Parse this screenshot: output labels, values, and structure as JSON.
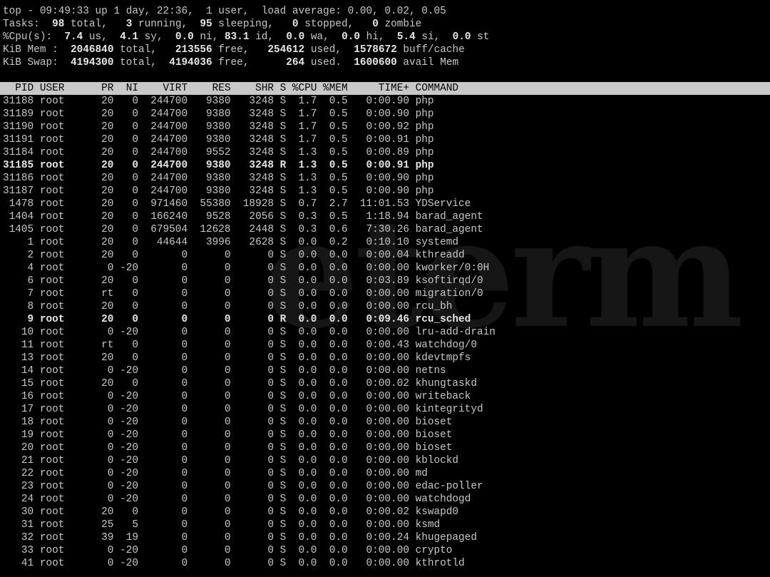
{
  "summary": {
    "top": {
      "label": "top - 09:49:33 up 1 day, 22:36,  1 user,  load average: 0.00, 0.02, 0.05"
    },
    "tasks": {
      "prefix": "Tasks: ",
      "total": " 98",
      "a": " total,   ",
      "running": "3",
      "b": " running,  ",
      "sleeping": "95",
      "c": " sleeping,   ",
      "stopped": "0",
      "d": " stopped,   ",
      "zombie": "0",
      "e": " zombie"
    },
    "cpu": {
      "prefix": "%Cpu(s):  ",
      "us": "7.4",
      "a": " us,  ",
      "sy": "4.1",
      "b": " sy,  ",
      "ni": "0.0",
      "c": " ni, ",
      "id": "83.1",
      "d": " id,  ",
      "wa": "0.0",
      "e": " wa,  ",
      "hi": "0.0",
      "f": " hi,  ",
      "si": "5.4",
      "g": " si,  ",
      "st": "0.0",
      "h": " st"
    },
    "mem": {
      "prefix": "KiB Mem :  ",
      "total": "2046840",
      "a": " total,   ",
      "free": "213556",
      "b": " free,   ",
      "used": "254612",
      "c": " used,  ",
      "cache": "1578672",
      "d": " buff/cache"
    },
    "swap": {
      "prefix": "KiB Swap:  ",
      "total": "4194300",
      "a": " total,  ",
      "free": "4194036",
      "b": " free,      ",
      "used": "264",
      "c": " used.  ",
      "avail": "1600600",
      "d": " avail Mem"
    }
  },
  "table": {
    "header": "  PID USER      PR  NI    VIRT    RES    SHR S %CPU %MEM     TIME+ COMMAND",
    "rows": [
      {
        "text": "31188 root      20   0  244700   9380   3248 S  1.7  0.5   0:00.90 php",
        "bold": false
      },
      {
        "text": "31189 root      20   0  244700   9380   3248 S  1.7  0.5   0:00.90 php",
        "bold": false
      },
      {
        "text": "31190 root      20   0  244700   9380   3248 S  1.7  0.5   0:00.92 php",
        "bold": false
      },
      {
        "text": "31191 root      20   0  244700   9380   3248 S  1.7  0.5   0:00.91 php",
        "bold": false
      },
      {
        "text": "31184 root      20   0  244700   9552   3248 S  1.3  0.5   0:00.89 php",
        "bold": false
      },
      {
        "text": "31185 root      20   0  244700   9380   3248 R  1.3  0.5   0:00.91 php",
        "bold": true
      },
      {
        "text": "31186 root      20   0  244700   9380   3248 S  1.3  0.5   0:00.90 php",
        "bold": false
      },
      {
        "text": "31187 root      20   0  244700   9380   3248 S  1.3  0.5   0:00.90 php",
        "bold": false
      },
      {
        "text": " 1478 root      20   0  971460  55380  18928 S  0.7  2.7  11:01.53 YDService",
        "bold": false
      },
      {
        "text": " 1404 root      20   0  166240   9528   2056 S  0.3  0.5   1:18.94 barad_agent",
        "bold": false
      },
      {
        "text": " 1405 root      20   0  679504  12628   2448 S  0.3  0.6   7:30.26 barad_agent",
        "bold": false
      },
      {
        "text": "    1 root      20   0   44644   3996   2628 S  0.0  0.2   0:10.10 systemd",
        "bold": false
      },
      {
        "text": "    2 root      20   0       0      0      0 S  0.0  0.0   0:00.04 kthreadd",
        "bold": false
      },
      {
        "text": "    4 root       0 -20       0      0      0 S  0.0  0.0   0:00.00 kworker/0:0H",
        "bold": false
      },
      {
        "text": "    6 root      20   0       0      0      0 S  0.0  0.0   0:03.89 ksoftirqd/0",
        "bold": false
      },
      {
        "text": "    7 root      rt   0       0      0      0 S  0.0  0.0   0:00.00 migration/0",
        "bold": false
      },
      {
        "text": "    8 root      20   0       0      0      0 S  0.0  0.0   0:00.00 rcu_bh",
        "bold": false
      },
      {
        "text": "    9 root      20   0       0      0      0 R  0.0  0.0   0:09.46 rcu_sched",
        "bold": true
      },
      {
        "text": "   10 root       0 -20       0      0      0 S  0.0  0.0   0:00.00 lru-add-drain",
        "bold": false
      },
      {
        "text": "   11 root      rt   0       0      0      0 S  0.0  0.0   0:00.43 watchdog/0",
        "bold": false
      },
      {
        "text": "   13 root      20   0       0      0      0 S  0.0  0.0   0:00.00 kdevtmpfs",
        "bold": false
      },
      {
        "text": "   14 root       0 -20       0      0      0 S  0.0  0.0   0:00.00 netns",
        "bold": false
      },
      {
        "text": "   15 root      20   0       0      0      0 S  0.0  0.0   0:00.02 khungtaskd",
        "bold": false
      },
      {
        "text": "   16 root       0 -20       0      0      0 S  0.0  0.0   0:00.00 writeback",
        "bold": false
      },
      {
        "text": "   17 root       0 -20       0      0      0 S  0.0  0.0   0:00.00 kintegrityd",
        "bold": false
      },
      {
        "text": "   18 root       0 -20       0      0      0 S  0.0  0.0   0:00.00 bioset",
        "bold": false
      },
      {
        "text": "   19 root       0 -20       0      0      0 S  0.0  0.0   0:00.00 bioset",
        "bold": false
      },
      {
        "text": "   20 root       0 -20       0      0      0 S  0.0  0.0   0:00.00 bioset",
        "bold": false
      },
      {
        "text": "   21 root       0 -20       0      0      0 S  0.0  0.0   0:00.00 kblockd",
        "bold": false
      },
      {
        "text": "   22 root       0 -20       0      0      0 S  0.0  0.0   0:00.00 md",
        "bold": false
      },
      {
        "text": "   23 root       0 -20       0      0      0 S  0.0  0.0   0:00.00 edac-poller",
        "bold": false
      },
      {
        "text": "   24 root       0 -20       0      0      0 S  0.0  0.0   0:00.00 watchdogd",
        "bold": false
      },
      {
        "text": "   30 root      20   0       0      0      0 S  0.0  0.0   0:00.02 kswapd0",
        "bold": false
      },
      {
        "text": "   31 root      25   5       0      0      0 S  0.0  0.0   0:00.00 ksmd",
        "bold": false
      },
      {
        "text": "   32 root      39  19       0      0      0 S  0.0  0.0   0:00.24 khugepaged",
        "bold": false
      },
      {
        "text": "   33 root       0 -20       0      0      0 S  0.0  0.0   0:00.00 crypto",
        "bold": false
      },
      {
        "text": "   41 root       0 -20       0      0      0 S  0.0  0.0   0:00.00 kthrotld",
        "bold": false
      }
    ]
  },
  "watermark": "eterm",
  "colors": {
    "background": "#000000",
    "text": "#c8c8c8",
    "header_bg": "#c8c8c8",
    "header_fg": "#000000"
  }
}
